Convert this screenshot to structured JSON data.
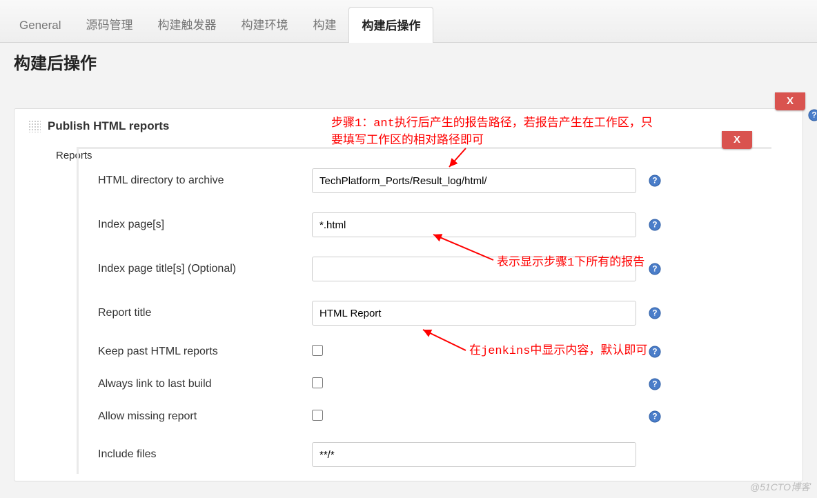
{
  "tabs": {
    "general": "General",
    "scm": "源码管理",
    "triggers": "构建触发器",
    "env": "构建环境",
    "build": "构建",
    "postbuild": "构建后操作"
  },
  "section_title": "构建后操作",
  "step": {
    "title": "Publish HTML reports",
    "reports_label": "Reports",
    "delete_label": "X"
  },
  "fields": {
    "html_dir": {
      "label": "HTML directory to archive",
      "value": "TechPlatform_Ports/Result_log/html/"
    },
    "index_page": {
      "label": "Index page[s]",
      "value": "*.html"
    },
    "index_title": {
      "label": "Index page title[s] (Optional)",
      "value": ""
    },
    "report_title": {
      "label": "Report title",
      "value": "HTML Report"
    },
    "keep_past": {
      "label": "Keep past HTML reports"
    },
    "always_link": {
      "label": "Always link to last build"
    },
    "allow_missing": {
      "label": "Allow missing report"
    },
    "include_files": {
      "label": "Include files",
      "value": "**/*"
    }
  },
  "annotations": {
    "step1": "步骤1：ant执行后产生的报告路径，若报告产生在工作区，只\n要填写工作区的相对路径即可",
    "step2": "表示显示步骤1下所有的报告",
    "step3": "在jenkins中显示内容，默认即可"
  },
  "watermark": "@51CTO博客"
}
